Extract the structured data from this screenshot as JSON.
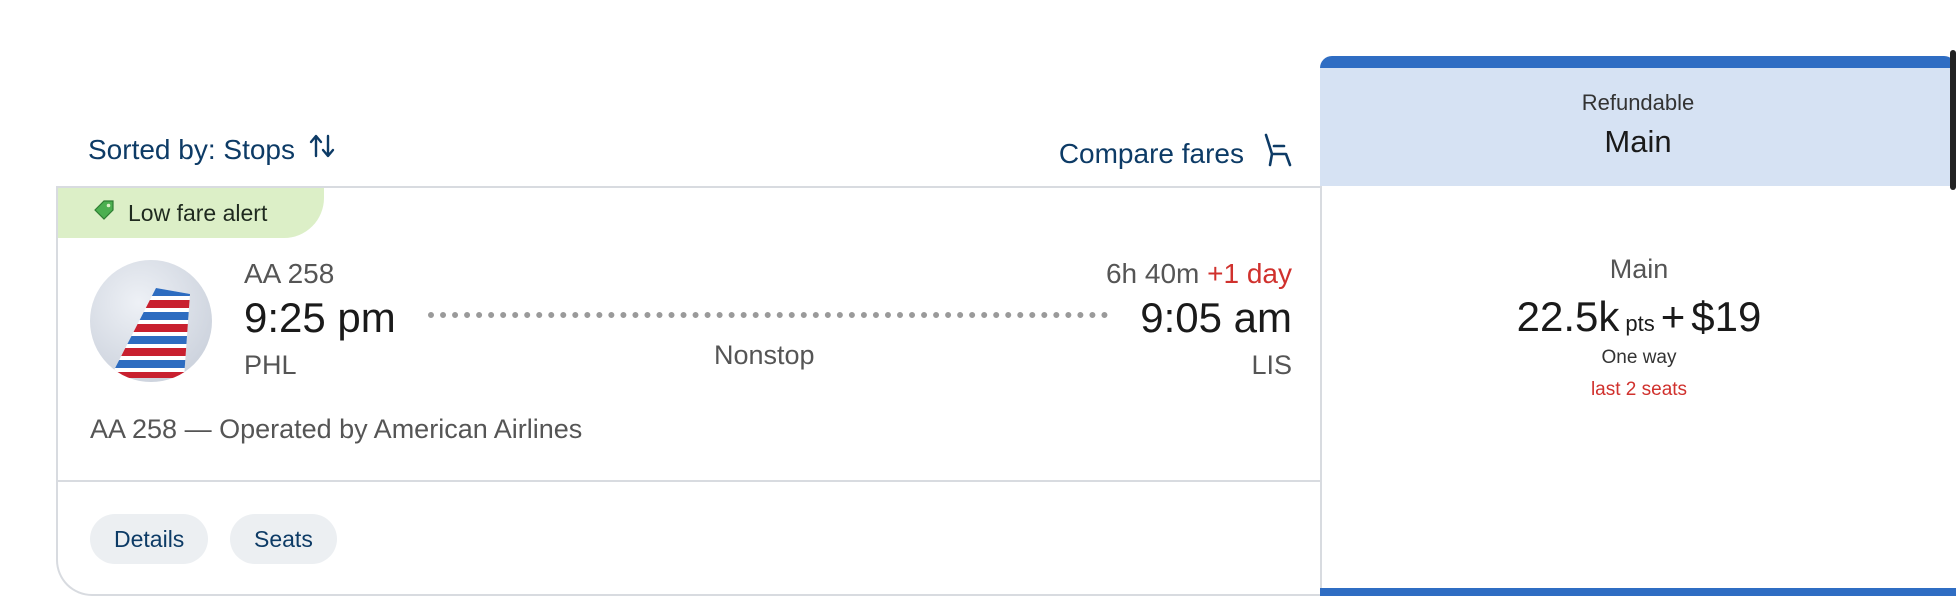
{
  "toolbar": {
    "sort_label": "Sorted by: Stops",
    "compare_label": "Compare fares"
  },
  "flight": {
    "alert": "Low fare alert",
    "number": "AA 258",
    "departure_time": "9:25 pm",
    "departure_code": "PHL",
    "arrival_time": "9:05 am",
    "arrival_code": "LIS",
    "duration": "6h 40m",
    "day_change": "+1 day",
    "stops": "Nonstop",
    "operated_by": "AA 258 — Operated by American Airlines",
    "details_label": "Details",
    "seats_label": "Seats"
  },
  "fare": {
    "header_sub": "Refundable",
    "header_title": "Main",
    "name": "Main",
    "points": "22.5k",
    "points_unit": "pts",
    "plus": "+",
    "cash": "$19",
    "trip_type": "One way",
    "availability": "last 2 seats"
  },
  "colors": {
    "accent_blue": "#2f6dc3",
    "header_bg": "#d6e2f3",
    "alert_bg": "#dcefc7",
    "warning_red": "#d0312d",
    "link_navy": "#0d3b66"
  },
  "icons": {
    "sort": "sort-arrows-icon",
    "compare": "seat-icon",
    "tag": "price-tag-icon",
    "airline": "american-airlines-tail-logo"
  }
}
